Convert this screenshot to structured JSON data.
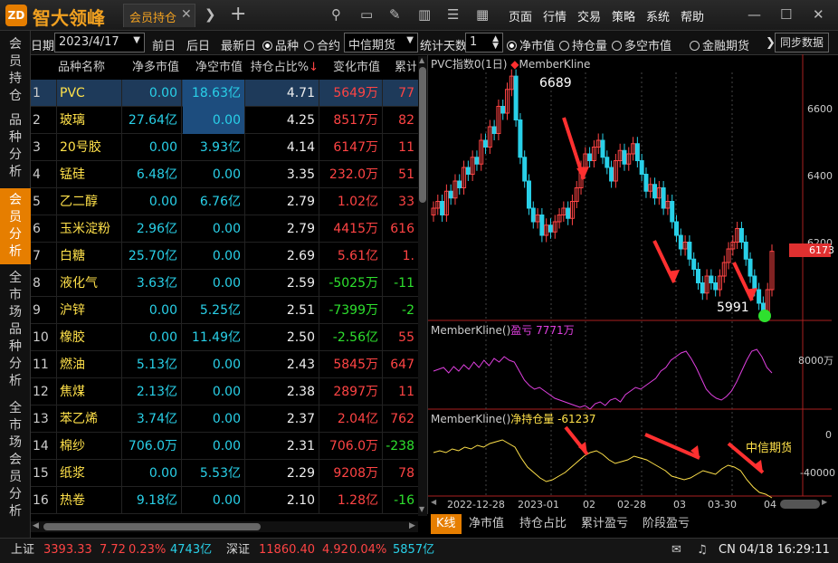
{
  "app": {
    "name": "智大领峰",
    "logo": "ZD",
    "tab": "会员持仓"
  },
  "menu": [
    "页面",
    "行情",
    "交易",
    "策略",
    "系统",
    "帮助"
  ],
  "toolbar": {
    "date_label": "日期",
    "date_value": "2023/4/17",
    "prev_day": "前日",
    "next_day": "后日",
    "latest_day": "最新日",
    "radio_variety": "品种",
    "radio_contract": "合约",
    "broker": "中信期货",
    "days_label": "统计天数",
    "days_value": "1",
    "radio_net": "净市值",
    "radio_pos": "持仓量",
    "radio_longshort": "多空市值",
    "finance": "金融期货",
    "sync": "同步数据"
  },
  "vtabs": [
    "会员持仓",
    "品种分析",
    "会员分析",
    "全市场品种分析",
    "全市场会员分析"
  ],
  "table": {
    "headers": [
      "品种名称",
      "净多市值",
      "净空市值",
      "持仓占比%",
      "变化市值",
      "累计"
    ],
    "rows": [
      {
        "i": "1",
        "name": "PVC",
        "long": "0.00",
        "short": "18.63亿",
        "pct": "4.71",
        "chg": "5649万",
        "cum": "77",
        "chg_color": "red",
        "cum_color": "red"
      },
      {
        "i": "2",
        "name": "玻璃",
        "long": "27.64亿",
        "short": "0.00",
        "pct": "4.25",
        "chg": "8517万",
        "cum": "82",
        "chg_color": "red",
        "cum_color": "red"
      },
      {
        "i": "3",
        "name": "20号胶",
        "long": "0.00",
        "short": "3.93亿",
        "pct": "4.14",
        "chg": "6147万",
        "cum": "11",
        "chg_color": "red",
        "cum_color": "red"
      },
      {
        "i": "4",
        "name": "锰硅",
        "long": "6.48亿",
        "short": "0.00",
        "pct": "3.35",
        "chg": "232.0万",
        "cum": "51",
        "chg_color": "red",
        "cum_color": "red"
      },
      {
        "i": "5",
        "name": "乙二醇",
        "long": "0.00",
        "short": "6.76亿",
        "pct": "2.79",
        "chg": "1.02亿",
        "cum": "33",
        "chg_color": "red",
        "cum_color": "red"
      },
      {
        "i": "6",
        "name": "玉米淀粉",
        "long": "2.96亿",
        "short": "0.00",
        "pct": "2.79",
        "chg": "4415万",
        "cum": "616",
        "chg_color": "red",
        "cum_color": "red"
      },
      {
        "i": "7",
        "name": "白糖",
        "long": "25.70亿",
        "short": "0.00",
        "pct": "2.69",
        "chg": "5.61亿",
        "cum": "1.",
        "chg_color": "red",
        "cum_color": "red"
      },
      {
        "i": "8",
        "name": "液化气",
        "long": "3.63亿",
        "short": "0.00",
        "pct": "2.59",
        "chg": "-5025万",
        "cum": "-11",
        "chg_color": "green",
        "cum_color": "green"
      },
      {
        "i": "9",
        "name": "沪锌",
        "long": "0.00",
        "short": "5.25亿",
        "pct": "2.51",
        "chg": "-7399万",
        "cum": "-2",
        "chg_color": "green",
        "cum_color": "green"
      },
      {
        "i": "10",
        "name": "橡胶",
        "long": "0.00",
        "short": "11.49亿",
        "pct": "2.50",
        "chg": "-2.56亿",
        "cum": "55",
        "chg_color": "green",
        "cum_color": "red"
      },
      {
        "i": "11",
        "name": "燃油",
        "long": "5.13亿",
        "short": "0.00",
        "pct": "2.43",
        "chg": "5845万",
        "cum": "647",
        "chg_color": "red",
        "cum_color": "red"
      },
      {
        "i": "12",
        "name": "焦煤",
        "long": "2.13亿",
        "short": "0.00",
        "pct": "2.38",
        "chg": "2897万",
        "cum": "11",
        "chg_color": "red",
        "cum_color": "red"
      },
      {
        "i": "13",
        "name": "苯乙烯",
        "long": "3.74亿",
        "short": "0.00",
        "pct": "2.37",
        "chg": "2.04亿",
        "cum": "762",
        "chg_color": "red",
        "cum_color": "red"
      },
      {
        "i": "14",
        "name": "棉纱",
        "long": "706.0万",
        "short": "0.00",
        "pct": "2.31",
        "chg": "706.0万",
        "cum": "-238",
        "chg_color": "red",
        "cum_color": "green"
      },
      {
        "i": "15",
        "name": "纸浆",
        "long": "0.00",
        "short": "5.53亿",
        "pct": "2.29",
        "chg": "9208万",
        "cum": "78",
        "chg_color": "red",
        "cum_color": "red"
      },
      {
        "i": "16",
        "name": "热卷",
        "long": "9.18亿",
        "short": "0.00",
        "pct": "2.10",
        "chg": "1.28亿",
        "cum": "-16",
        "chg_color": "red",
        "cum_color": "green"
      }
    ]
  },
  "chart": {
    "main_title": "PVC指数0(1日)",
    "indicator": "MemberKline",
    "high_label": "6689",
    "low_label": "5991",
    "price_ticks": [
      "6600",
      "6400",
      "6200"
    ],
    "last_price": "6173",
    "panel2_title": "MemberKline()",
    "panel2_metric": "盈亏 7771万",
    "panel2_tick": "8000万",
    "panel3_title": "MemberKline()",
    "panel3_metric": "净持仓量 -61237",
    "panel3_ticks": [
      "0",
      "-40000"
    ],
    "panel3_label": "中信期货",
    "date_ticks": [
      "2022-12-28",
      "2023-01",
      "02",
      "02-28",
      "03",
      "03-30",
      "04"
    ],
    "tabs": [
      "K线",
      "净市值",
      "持仓占比",
      "累计盈亏",
      "阶段盈亏"
    ],
    "colors": {
      "up": "#ff4444",
      "down": "#29d0e8",
      "profit": "#e040e0",
      "net": "#ffe14a",
      "accent": "#e67e00"
    }
  },
  "status": {
    "sh_label": "上证",
    "sh_val": "3393.33",
    "sh_chg": "7.72",
    "sh_pct": "0.23%",
    "sh_amt": "4743亿",
    "sz_label": "深证",
    "sz_val": "11860.40",
    "sz_chg": "4.92",
    "sz_pct": "0.04%",
    "sz_amt": "5857亿",
    "clock": "CN 04/18 16:29:11"
  }
}
